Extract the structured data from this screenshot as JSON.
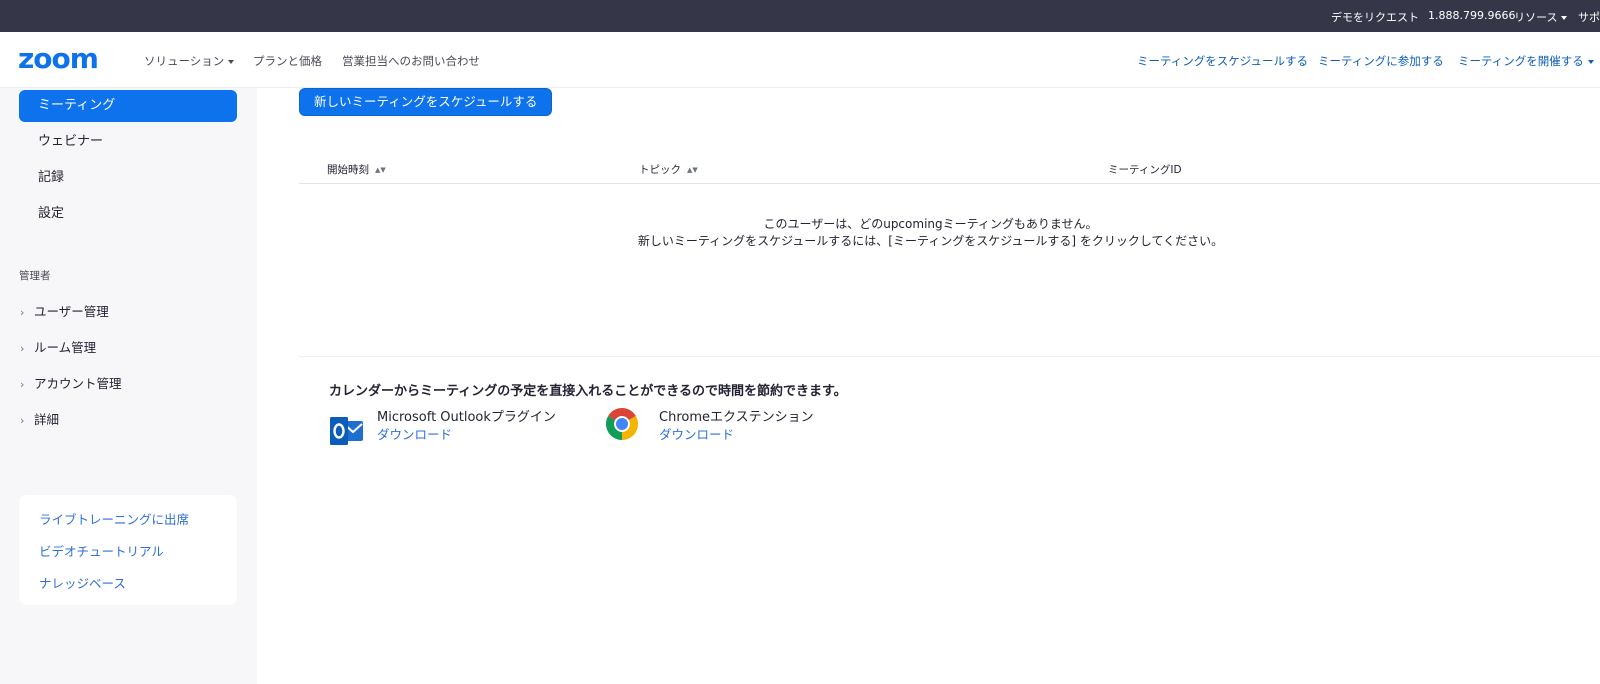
{
  "topbar": {
    "demo_request": "デモをリクエスト",
    "phone": "1.888.799.9666",
    "resources": "リソース",
    "support": "サポ"
  },
  "header": {
    "logo_text": "zoom",
    "nav": {
      "solutions": "ソリューション",
      "plans": "プランと価格",
      "contact_sales": "営業担当へのお問い合わせ"
    },
    "actions": {
      "schedule": "ミーティングをスケジュールする",
      "join": "ミーティングに参加する",
      "host": "ミーティングを開催する"
    }
  },
  "sidebar": {
    "items": [
      {
        "label": "ミーティング",
        "active": true
      },
      {
        "label": "ウェビナー",
        "active": false
      },
      {
        "label": "記録",
        "active": false
      },
      {
        "label": "設定",
        "active": false
      }
    ],
    "admin_label": "管理者",
    "admin_items": [
      {
        "label": "ユーザー管理"
      },
      {
        "label": "ルーム管理"
      },
      {
        "label": "アカウント管理"
      },
      {
        "label": "詳細"
      }
    ],
    "help_links": [
      {
        "label": "ライブトレーニングに出席"
      },
      {
        "label": "ビデオチュートリアル"
      },
      {
        "label": "ナレッジベース"
      }
    ]
  },
  "main": {
    "schedule_button": "新しいミーティングをスケジュールする",
    "table": {
      "columns": [
        "開始時刻",
        "トピック",
        "ミーティングID"
      ]
    },
    "empty_line1": "このユーザーは、どのupcomingミーティングもありません。",
    "empty_line2": "新しいミーティングをスケジュールするには、[ミーティングをスケジュールする] をクリックしてください。",
    "calendar": {
      "title": "カレンダーからミーティングの予定を直接入れることができるので時間を節約できます。",
      "plugins": [
        {
          "name": "Microsoft Outlookプラグイン",
          "download": "ダウンロード",
          "icon": "outlook-icon"
        },
        {
          "name": "Chromeエクステンション",
          "download": "ダウンロード",
          "icon": "chrome-icon"
        }
      ]
    }
  },
  "colors": {
    "topbar_bg": "#363649",
    "accent": "#0e72ed",
    "link": "#2d6fdc",
    "sidebar_bg": "#f7f7fa"
  }
}
